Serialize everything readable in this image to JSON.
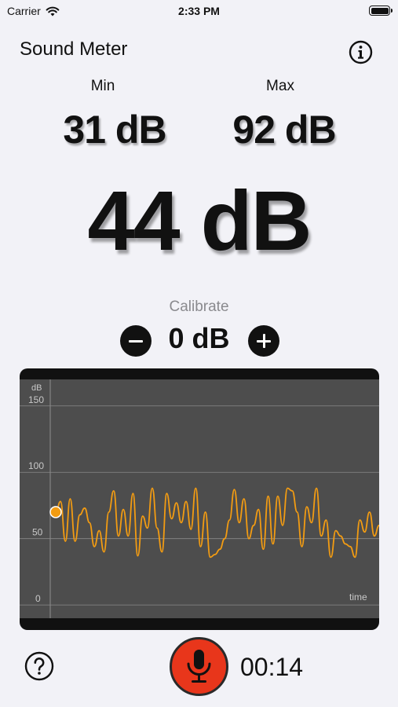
{
  "status_bar": {
    "carrier": "Carrier",
    "time": "2:33 PM"
  },
  "header": {
    "title": "Sound Meter",
    "info_icon": "info-circle-icon"
  },
  "stats": {
    "min_label": "Min",
    "min_value": "31 dB",
    "max_label": "Max",
    "max_value": "92 dB",
    "current_value": "44 dB"
  },
  "calibrate": {
    "label": "Calibrate",
    "value": "0 dB",
    "minus_icon": "minus-circle-icon",
    "plus_icon": "plus-circle-icon"
  },
  "chart_data": {
    "type": "line",
    "ylabel": "dB",
    "xlabel": "time",
    "yticks": [
      150,
      100,
      50,
      0
    ],
    "ylim": [
      -10,
      170
    ],
    "grid": true,
    "series_color": "#f39c12",
    "series": [
      {
        "values": [
          70,
          78,
          48,
          80,
          48,
          68,
          73,
          62,
          44,
          56,
          40,
          70,
          86,
          52,
          72,
          52,
          84,
          37,
          67,
          58,
          88,
          58,
          40,
          84,
          65,
          77,
          62,
          78,
          57,
          88,
          44,
          70,
          36,
          38,
          42,
          50,
          64,
          87,
          62,
          80,
          50,
          60,
          72,
          42,
          82,
          46,
          82,
          60,
          88,
          86,
          70,
          44,
          74,
          62,
          88,
          52,
          64,
          36,
          56,
          52,
          46,
          44,
          36,
          64,
          55,
          70,
          52,
          60
        ]
      }
    ],
    "current_point_value": 70
  },
  "bottom": {
    "help_icon": "question-circle-icon",
    "mic_icon": "microphone-icon",
    "timer": "00:14"
  },
  "colors": {
    "accent": "#f39c12",
    "record": "#e8361b",
    "background": "#f2f2f7",
    "chart_bg": "#4d4d4d"
  }
}
